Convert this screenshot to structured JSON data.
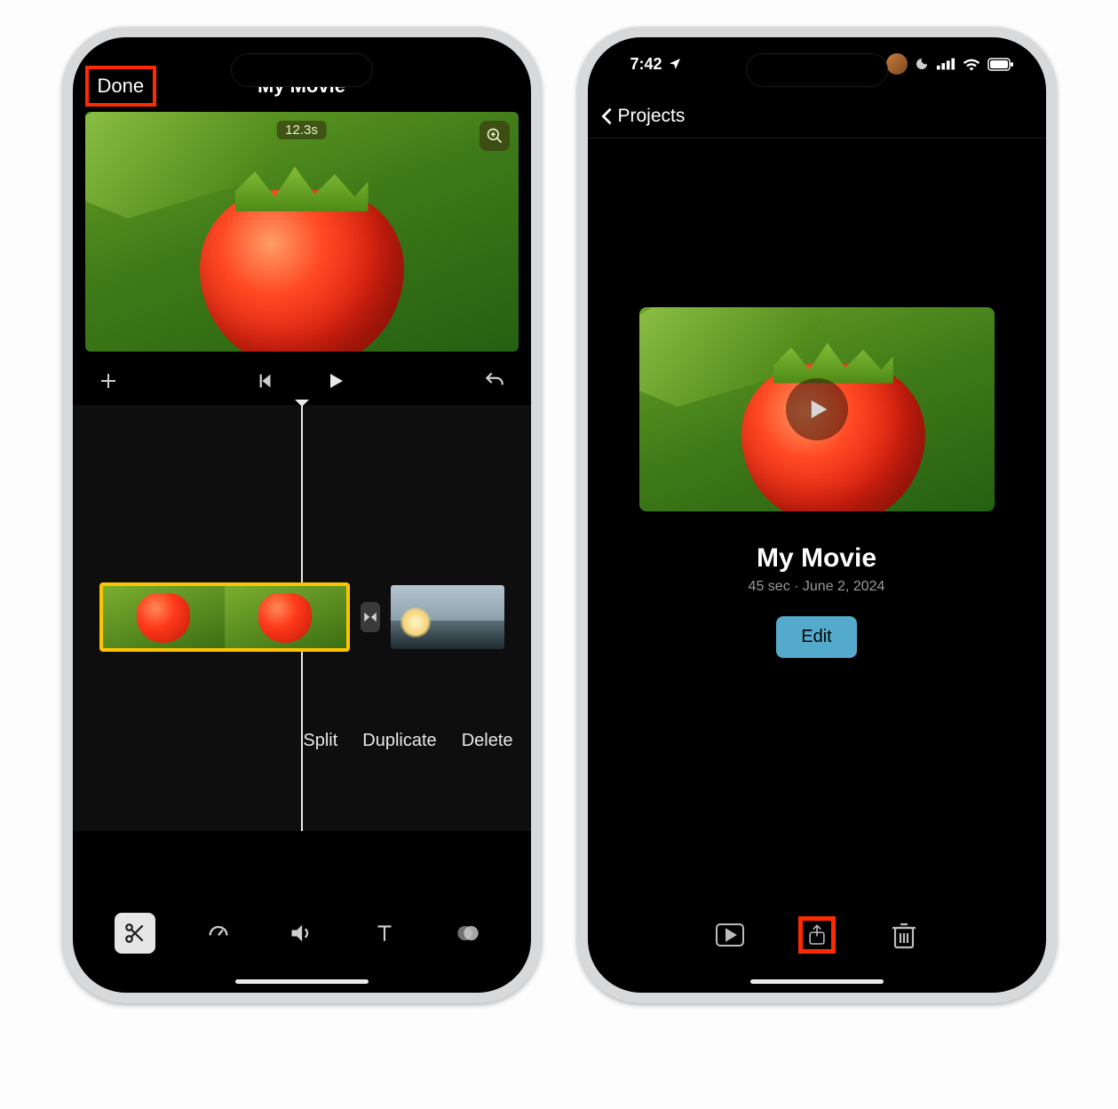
{
  "left": {
    "done": "Done",
    "title": "My Movie",
    "clip_duration": "12.3s",
    "actions": {
      "split": "Split",
      "duplicate": "Duplicate",
      "delete": "Delete"
    },
    "highlight": "done-button"
  },
  "right": {
    "status_time": "7:42",
    "back_label": "Projects",
    "project_title": "My Movie",
    "project_meta": "45 sec · June 2, 2024",
    "edit_label": "Edit",
    "highlight": "share-button"
  }
}
